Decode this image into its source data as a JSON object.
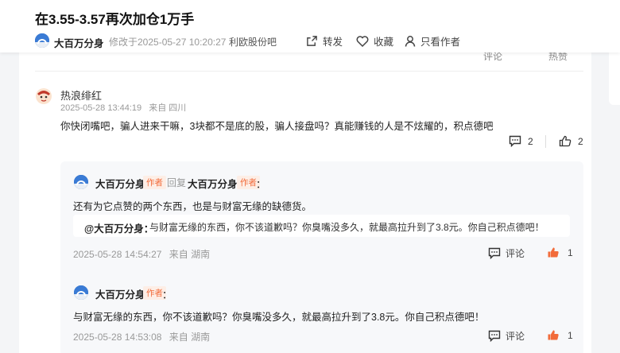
{
  "post": {
    "title": "在3.55-3.57再次加仓1万手",
    "author": "大百万分身",
    "modified": "修改于2025-05-27 10:20:27",
    "forum": "利欧股份吧"
  },
  "actions": {
    "share": "转发",
    "favorite": "收藏",
    "author_only": "只看作者"
  },
  "prev_comment_actions": {
    "comment": "评论",
    "hot": "热赞"
  },
  "comment": {
    "user": "热浪绯红",
    "time": "2025-05-28 13:44:19",
    "location": "来自 四川",
    "text": "你快闭嘴吧，骗人进来干嘛，3块都不是底的股，骗人接盘吗？真能赚钱的人是不炫耀的，积点德吧",
    "reply_count": "2",
    "like_count": "2"
  },
  "replies": [
    {
      "user": "大百万分身",
      "author_tag": "作者",
      "reply_word": "回复",
      "reply_to": "大百万分身",
      "reply_to_tag": "作者",
      "colon": "：",
      "text": "还有为它点赞的两个东西，也是与财富无缘的缺德货。",
      "quote_user": "@大百万分身：",
      "quote_text": "与财富无缘的东西，你不该道歉吗？你臭嘴没多久，就最高拉升到了3.8元。你自己积点德吧！",
      "time": "2025-05-28 14:54:27",
      "location": "来自 湖南",
      "comment_label": "评论",
      "likes": "1"
    },
    {
      "user": "大百万分身",
      "author_tag": "作者",
      "colon": "：",
      "text": "与财富无缘的东西，你不该道歉吗？你臭嘴没多久，就最高拉升到了3.8元。你自己积点德吧！",
      "time": "2025-05-28 14:53:08",
      "location": "来自 湖南",
      "comment_label": "评论",
      "likes": "1"
    }
  ],
  "icons": [
    "share-icon",
    "heart-icon",
    "user-icon",
    "comment-icon",
    "thumb-up-icon"
  ],
  "colors": {
    "accent": "#f26b3a",
    "avatar_blue": "#1e5aa8"
  }
}
